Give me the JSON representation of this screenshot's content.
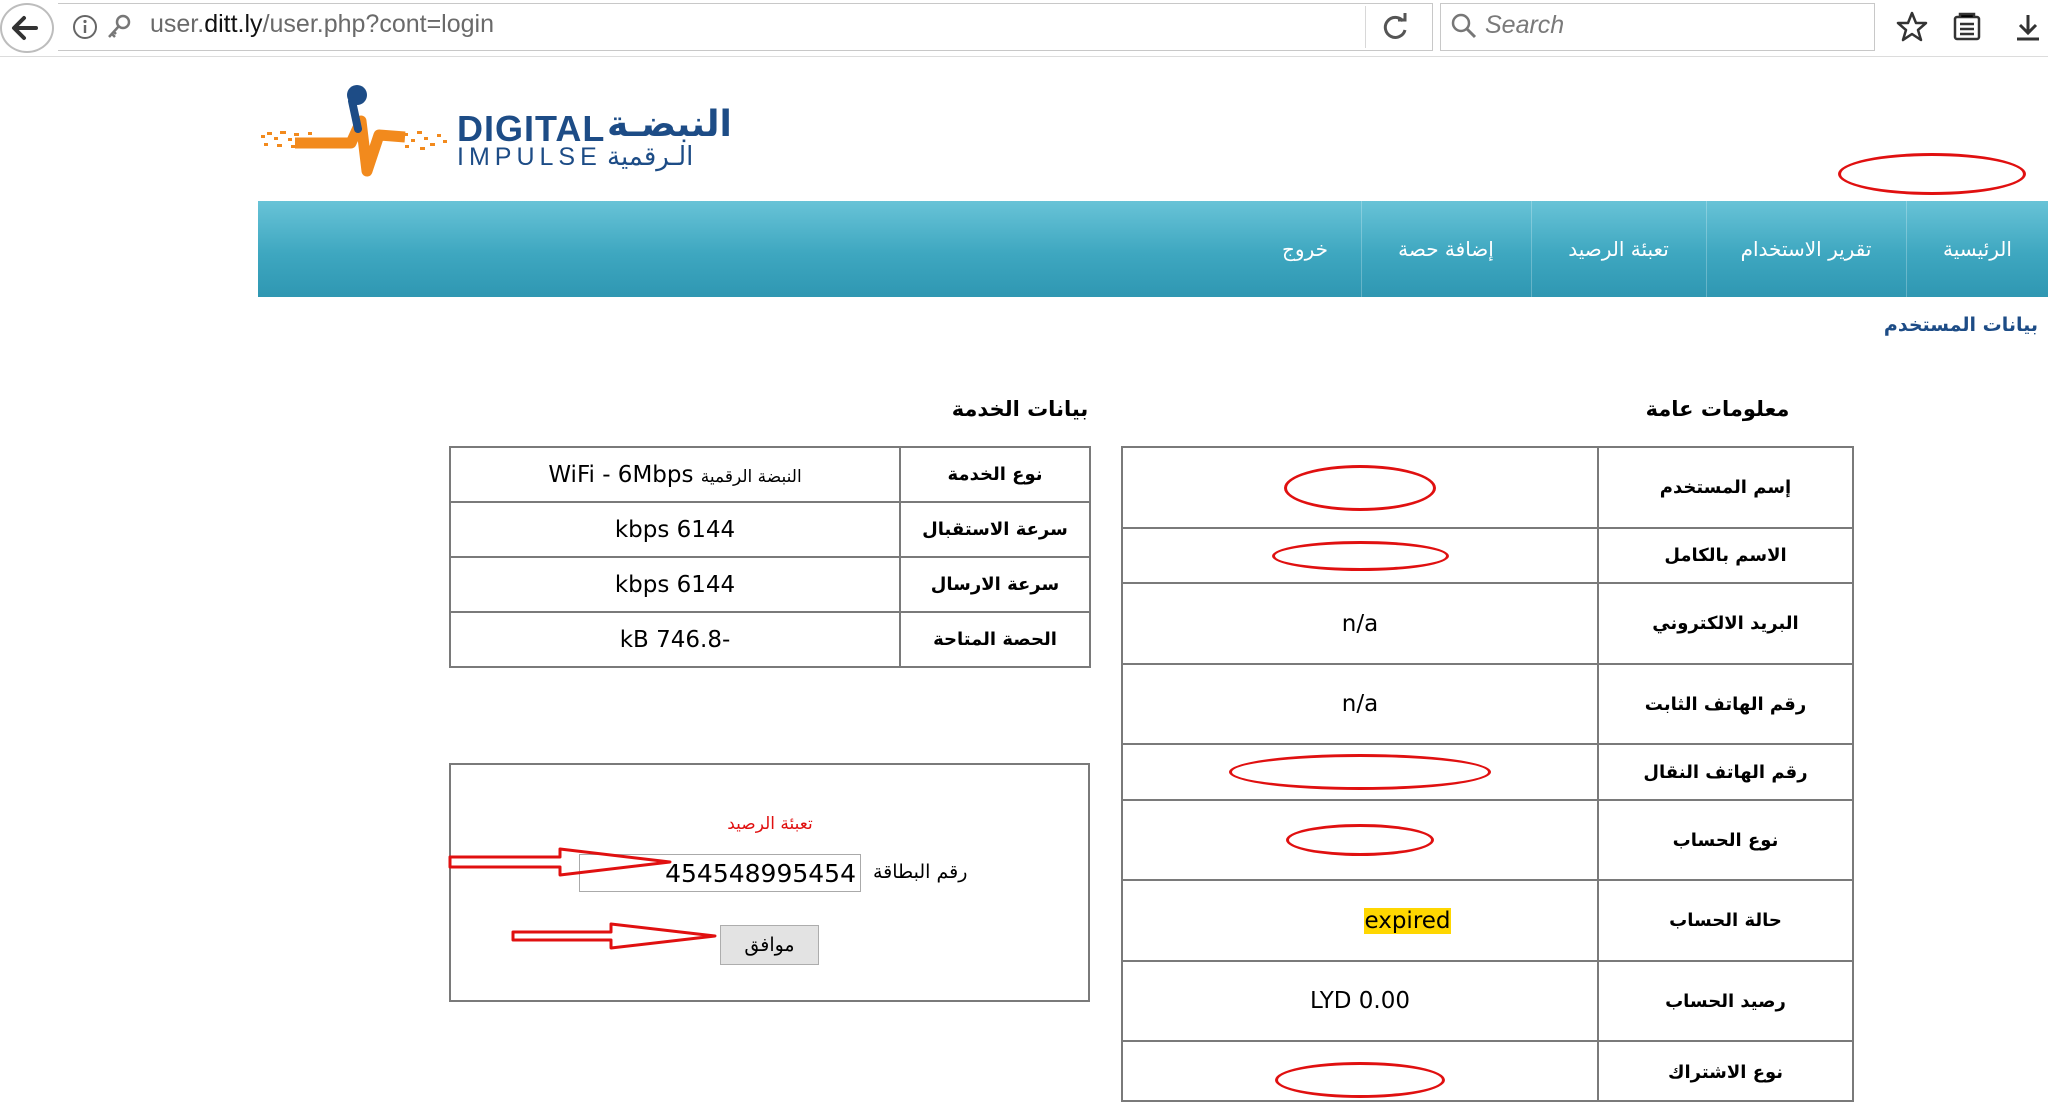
{
  "browser": {
    "url_prefix": "user.",
    "url_host": "ditt.ly",
    "url_path": "/user.php?cont=login",
    "search_placeholder": "Search"
  },
  "logo": {
    "en_line1": "DIGITAL",
    "en_line2": "IMPULSE",
    "ar_line1": "النبضـة",
    "ar_line2": "الـرقمية"
  },
  "nav": {
    "items": [
      "الرئيسية",
      "تقرير الاستخدام",
      "تعبئة الرصيد",
      "إضافة حصة",
      "خروج"
    ]
  },
  "page_title": "بيانات المستخدم",
  "general": {
    "title": "معلومات عامة",
    "rows": [
      {
        "label": "إسم المستخدم",
        "value": ""
      },
      {
        "label": "الاسم بالكامل",
        "value": ""
      },
      {
        "label": "البريد الالكتروني",
        "value": "n/a"
      },
      {
        "label": "رقم الهاتف الثابت",
        "value": "n/a"
      },
      {
        "label": "رقم الهاتف النقال",
        "value": ""
      },
      {
        "label": "نوع الحساب",
        "value": ""
      },
      {
        "label": "حالة الحساب",
        "value": "expired"
      },
      {
        "label": "رصيد الحساب",
        "value": "LYD 0.00"
      },
      {
        "label": "نوع الاشتراك",
        "value": ""
      }
    ]
  },
  "service": {
    "title": "بيانات الخدمة",
    "rows": [
      {
        "label": "نوع الخدمة",
        "value_ar": "النبضة الرقمية",
        "value": "WiFi - 6Mbps"
      },
      {
        "label": "سرعة الاستقبال",
        "value": "kbps 6144"
      },
      {
        "label": "سرعة الارسال",
        "value": "kbps 6144"
      },
      {
        "label": "الحصة المتاحة",
        "value": "kB 746.8-"
      }
    ]
  },
  "recharge": {
    "title": "تعبئة الرصيد",
    "card_label": "رقم البطاقة",
    "card_value": "454548995454",
    "ok_label": "موافق"
  },
  "colors": {
    "nav_top": "#68c3d7",
    "nav_bottom": "#2f97b2",
    "brand_blue": "#1d4c86",
    "annotation_red": "#e01010",
    "status_highlight": "#ffd700"
  }
}
